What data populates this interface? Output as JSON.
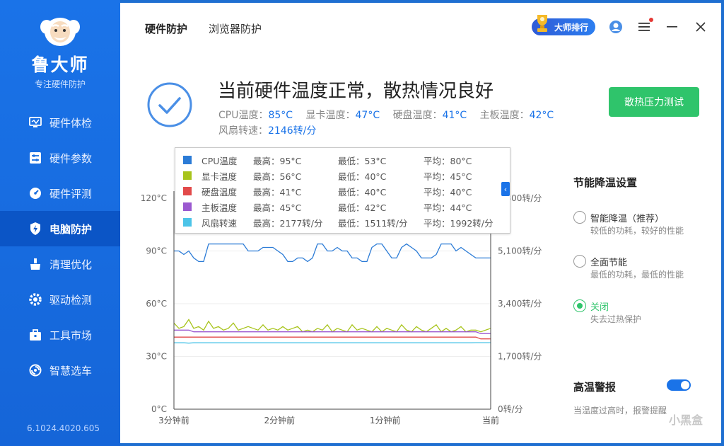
{
  "app": {
    "name": "鲁大师",
    "tagline": "专注硬件防护",
    "version": "6.1024.4020.605"
  },
  "sidebar": {
    "items": [
      {
        "label": "硬件体检",
        "icon": "monitor-check-icon",
        "active": false
      },
      {
        "label": "硬件参数",
        "icon": "sliders-icon",
        "active": false
      },
      {
        "label": "硬件评测",
        "icon": "speedometer-icon",
        "active": false
      },
      {
        "label": "电脑防护",
        "icon": "shield-bolt-icon",
        "active": true
      },
      {
        "label": "清理优化",
        "icon": "broom-icon",
        "active": false
      },
      {
        "label": "驱动检测",
        "icon": "gear-icon",
        "active": false
      },
      {
        "label": "工具市场",
        "icon": "toolbox-icon",
        "active": false
      },
      {
        "label": "智慧选车",
        "icon": "car-wheel-icon",
        "active": false
      }
    ]
  },
  "header": {
    "tabs": [
      {
        "label": "硬件防护",
        "active": true
      },
      {
        "label": "浏览器防护",
        "active": false
      }
    ],
    "rank_label": "大师排行"
  },
  "status": {
    "title": "当前硬件温度正常，散热情况良好",
    "cpu_label": "CPU温度：",
    "cpu_value": "85°C",
    "gpu_label": "显卡温度：",
    "gpu_value": "47°C",
    "disk_label": "硬盘温度：",
    "disk_value": "41°C",
    "board_label": "主板温度：",
    "board_value": "42°C",
    "fan_label": "风扇转速：",
    "fan_value": "2146转/分",
    "stress_button": "散热压力测试"
  },
  "legend": [
    {
      "name": "CPU温度",
      "max": "最高：95°C",
      "min": "最低：53°C",
      "avg": "平均：80°C",
      "color": "#2b7bd6"
    },
    {
      "name": "显卡温度",
      "max": "最高：56°C",
      "min": "最低：40°C",
      "avg": "平均：45°C",
      "color": "#a8c41c"
    },
    {
      "name": "硬盘温度",
      "max": "最高：41°C",
      "min": "最低：40°C",
      "avg": "平均：40°C",
      "color": "#e24a4a"
    },
    {
      "name": "主板温度",
      "max": "最高：45°C",
      "min": "最低：42°C",
      "avg": "平均：44°C",
      "color": "#9b59d0"
    },
    {
      "name": "风扇转速",
      "max": "最高：2177转/分",
      "min": "最低：1511转/分",
      "avg": "平均：1992转/分",
      "color": "#4cc4e8"
    }
  ],
  "chart_data": {
    "type": "line",
    "x_tick_labels": [
      "3分钟前",
      "2分钟前",
      "1分钟前",
      "当前"
    ],
    "y_left_ticks": [
      "0°C",
      "30°C",
      "60°C",
      "90°C",
      "120°C"
    ],
    "y_right_ticks": [
      "0转/分",
      "1,700转/分",
      "3,400转/分",
      "5,100转/分",
      "6,800转/分"
    ],
    "ylim_left": [
      0,
      120
    ],
    "ylim_right": [
      0,
      6800
    ],
    "grid": true,
    "series": [
      {
        "name": "CPU温度",
        "axis": "left",
        "color": "#2b7bd6",
        "values": [
          90,
          90,
          88,
          90,
          86,
          84,
          84,
          94,
          94,
          94,
          94,
          94,
          94,
          94,
          94,
          90,
          90,
          90,
          92,
          92,
          92,
          90,
          88,
          84,
          84,
          86,
          86,
          84,
          86,
          94,
          94,
          90,
          90,
          92,
          90,
          90,
          86,
          86,
          84,
          84,
          92,
          94,
          94,
          90,
          86,
          86,
          92,
          94,
          92,
          90,
          86,
          86,
          86,
          88,
          94,
          94,
          94,
          90,
          92,
          90,
          88,
          86,
          86,
          86,
          86
        ]
      },
      {
        "name": "显卡温度",
        "axis": "left",
        "color": "#a8c41c",
        "values": [
          49,
          46,
          47,
          51,
          46,
          47,
          45,
          50,
          46,
          47,
          45,
          46,
          49,
          45,
          46,
          47,
          46,
          45,
          48,
          45,
          46,
          45,
          47,
          45,
          46,
          47,
          44,
          45,
          44,
          46,
          45,
          48,
          44,
          46,
          45,
          44,
          48,
          45,
          46,
          45,
          44,
          47,
          44,
          46,
          45,
          44,
          48,
          45,
          44,
          47,
          45,
          44,
          46,
          48,
          44,
          46,
          44,
          45,
          47,
          44,
          45,
          45,
          44,
          45,
          46
        ]
      },
      {
        "name": "硬盘温度",
        "axis": "left",
        "color": "#e24a4a",
        "values": [
          41,
          41,
          41,
          41,
          41,
          41,
          41,
          41,
          41,
          41,
          41,
          41,
          41,
          41,
          41,
          41,
          41,
          41,
          41,
          41,
          41,
          41,
          41,
          41,
          41,
          41,
          41,
          41,
          41,
          41,
          41,
          41,
          41,
          41,
          41,
          41,
          41,
          41,
          41,
          41,
          41,
          41,
          41,
          41,
          41,
          41,
          41,
          41,
          41,
          41,
          41,
          41,
          41,
          41,
          41,
          41,
          41,
          41,
          41,
          41,
          41,
          41,
          40,
          40,
          40
        ]
      },
      {
        "name": "主板温度",
        "axis": "left",
        "color": "#9b59d0",
        "values": [
          45,
          45,
          45,
          45,
          44,
          44,
          44,
          44,
          44,
          44,
          44,
          44,
          44,
          44,
          44,
          44,
          44,
          44,
          44,
          44,
          44,
          44,
          44,
          44,
          44,
          44,
          44,
          44,
          44,
          44,
          44,
          44,
          44,
          44,
          44,
          44,
          44,
          44,
          44,
          44,
          44,
          44,
          44,
          44,
          44,
          44,
          44,
          44,
          44,
          44,
          44,
          44,
          44,
          44,
          44,
          44,
          44,
          44,
          44,
          44,
          44,
          44,
          43,
          43,
          43
        ]
      },
      {
        "name": "风扇转速",
        "axis": "right",
        "color": "#4cc4e8",
        "values": [
          2140,
          2140,
          2140,
          2130,
          2140,
          2140,
          2140,
          2140,
          2140,
          2140,
          2140,
          2140,
          2140,
          2140,
          2140,
          2140,
          2140,
          2140,
          2140,
          2140,
          2140,
          2140,
          2140,
          2140,
          2140,
          2140,
          2140,
          2140,
          2140,
          2140,
          2140,
          2140,
          2140,
          2140,
          2140,
          2140,
          2140,
          2140,
          2140,
          2140,
          2140,
          2140,
          2140,
          2140,
          2140,
          2140,
          2140,
          2140,
          2140,
          2140,
          2140,
          2140,
          2140,
          2140,
          2140,
          2140,
          2140,
          2140,
          2140,
          2140,
          2140,
          2146,
          2146,
          2146,
          2146
        ]
      }
    ]
  },
  "settings": {
    "title": "节能降温设置",
    "options": [
      {
        "label": "智能降温（推荐）",
        "desc": "较低的功耗，较好的性能",
        "selected": false
      },
      {
        "label": "全面节能",
        "desc": "最低的功耗，最低的性能",
        "selected": false
      },
      {
        "label": "关闭",
        "desc": "失去过热保护",
        "selected": true
      }
    ],
    "alarm_title": "高温警报",
    "alarm_on": true,
    "alarm_desc": "当温度过高时，报警提醒"
  },
  "watermark": "小黑盒",
  "colors": {
    "accent": "#1a73e8",
    "green": "#2fc46b"
  }
}
